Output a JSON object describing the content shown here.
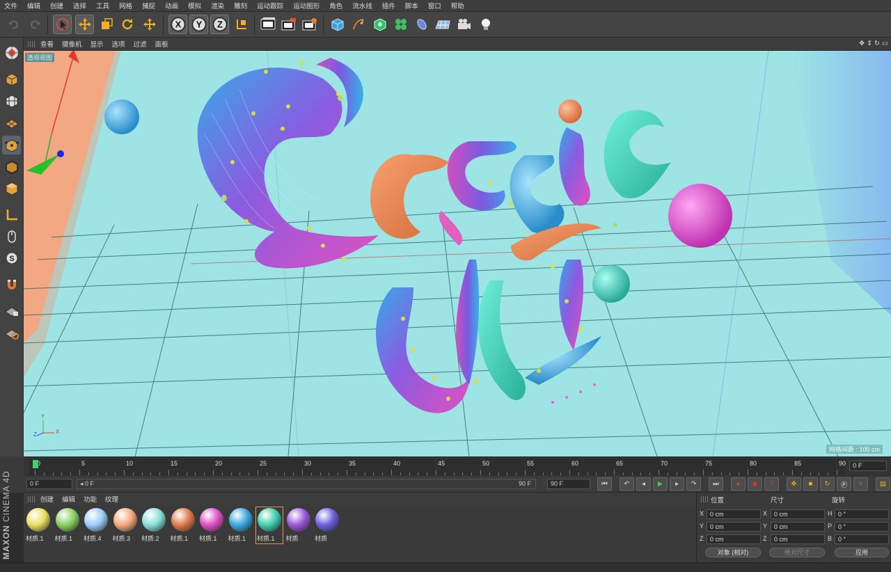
{
  "menu": [
    "文件",
    "编辑",
    "创建",
    "选择",
    "工具",
    "网格",
    "捕捉",
    "动画",
    "模拟",
    "渲染",
    "雕刻",
    "运动跟踪",
    "运动图形",
    "角色",
    "流水线",
    "插件",
    "脚本",
    "窗口",
    "帮助"
  ],
  "toolbar": {
    "axes": [
      "X",
      "Y",
      "Z"
    ]
  },
  "viewport_menu": [
    "查看",
    "摄像机",
    "显示",
    "选项",
    "过滤",
    "面板"
  ],
  "viewport": {
    "label": "透视视图",
    "grid_spacing": "网格间距 : 100 cm",
    "axis_x": "X",
    "axis_y": "Y",
    "axis_z": "Z"
  },
  "timeline": {
    "labels": [
      "0",
      "5",
      "10",
      "15",
      "20",
      "25",
      "30",
      "35",
      "40",
      "45",
      "50",
      "55",
      "60",
      "65",
      "70",
      "75",
      "80",
      "85",
      "90"
    ],
    "end_frame": "0 F"
  },
  "transport": {
    "current": "0 F",
    "start": "◂ 0 F",
    "end_inner": "90 F",
    "end": "90 F"
  },
  "brand": {
    "line1": "MAXON",
    "line2": "CINEMA 4D"
  },
  "material_menu": [
    "创建",
    "编辑",
    "功能",
    "纹理"
  ],
  "materials": [
    {
      "label": "材质.1",
      "color": "#e8e060"
    },
    {
      "label": "材质.1",
      "color": "#88d060"
    },
    {
      "label": "材质.4",
      "color": "#9cccf8"
    },
    {
      "label": "材质.3",
      "color": "#f5a87a"
    },
    {
      "label": "材质.2",
      "color": "#88e0d8"
    },
    {
      "label": "材质.1",
      "color": "#e07a4a"
    },
    {
      "label": "材质.1",
      "color": "#e050c8"
    },
    {
      "label": "材质.1",
      "color": "#3aa8e0"
    },
    {
      "label": "材质.1",
      "color": "#40d0b0"
    },
    {
      "label": "材质",
      "color": "#9a58d8"
    },
    {
      "label": "材质",
      "color": "#6a60e0"
    }
  ],
  "attributes": {
    "headers": {
      "position": "位置",
      "size": "尺寸",
      "rotation": "旋转"
    },
    "rows": [
      {
        "p_axis": "X",
        "p_val": "0 cm",
        "s_axis": "X",
        "s_val": "0 cm",
        "r_axis": "H",
        "r_val": "0 °"
      },
      {
        "p_axis": "Y",
        "p_val": "0 cm",
        "s_axis": "Y",
        "s_val": "0 cm",
        "r_axis": "P",
        "r_val": "0 °"
      },
      {
        "p_axis": "Z",
        "p_val": "0 cm",
        "s_axis": "Z",
        "s_val": "0 cm",
        "r_axis": "B",
        "r_val": "0 °"
      }
    ],
    "coord_mode": "对象 (相对)",
    "size_mode": "绝对尺寸",
    "apply": "应用"
  },
  "colors": {
    "viewport_bg": "#9fe6e6",
    "accent": "#e0a040"
  }
}
